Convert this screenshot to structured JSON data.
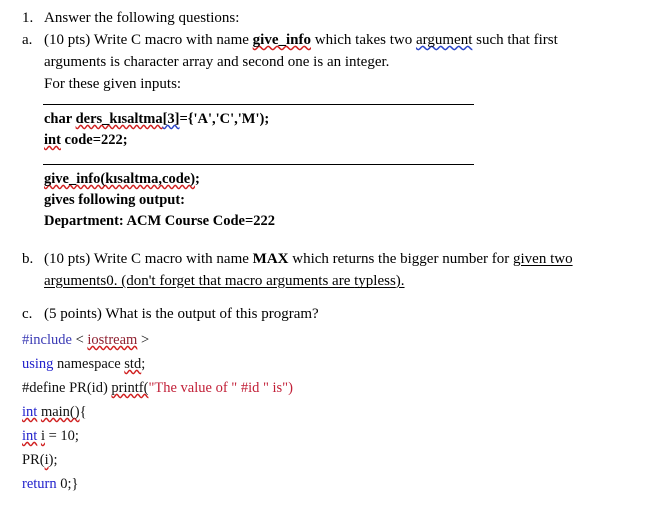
{
  "document": {
    "type": "exam-question-sheet",
    "colors": {
      "text": "#000000",
      "keyword_blue": "#2222CC",
      "string_red": "#C22038",
      "spell_squiggle_red": "#D02020",
      "grammar_squiggle_blue": "#2B45C8",
      "background": "#FFFFFF"
    },
    "questions": [
      {
        "marker": "1.",
        "lines": [
          "Answer the following questions:"
        ]
      },
      {
        "marker": "a.",
        "line1_a": "(10 pts) Write C macro with name ",
        "line1_bold": "give_info",
        "line1_b": " which takes two ",
        "line1_grammar": "argument",
        "line1_c": " such that first",
        "line2": "arguments is character array and second one is an integer.",
        "line3": "For these given inputs:"
      },
      {
        "marker": "b.",
        "line1_a": "(10 pts) Write C macro with name ",
        "line1_bold": "MAX",
        "line1_b": " which returns the bigger number for ",
        "line1_underline": "given two",
        "line2_underline_a": "arguments0. (don't forget that macro arguments are ",
        "line2_spell": "typless",
        "line2_underline_b": ")."
      },
      {
        "marker": "c.",
        "lines": [
          "(5 points) What is the output of this program?"
        ]
      }
    ],
    "given_inputs_block": {
      "line1_a": "char ",
      "line1_spell": "ders_kısaltma",
      "line1_b": "[3]",
      "line1_c": "={'A','C','M');",
      "line2_spell": "int",
      "line2_rest": " code=222;"
    },
    "output_block": {
      "line1_spell": "give_info(kısaltma,code)",
      "line1_rest": ";",
      "line2": "gives following output:",
      "line3": "Department: ACM Course Code=222"
    },
    "program": {
      "lines": [
        {
          "id": "include",
          "tokens": [
            {
              "text": "#include",
              "style": "pre"
            },
            {
              "text": " < ",
              "style": "idr"
            },
            {
              "text": "iostream",
              "style": "inc-name sq-red"
            },
            {
              "text": " >",
              "style": "idr"
            }
          ]
        },
        {
          "id": "using",
          "tokens": [
            {
              "text": "using",
              "style": "kw"
            },
            {
              "text": " namespace ",
              "style": "idr"
            },
            {
              "text": "std",
              "style": "idr sq-red"
            },
            {
              "text": ";",
              "style": "idr"
            }
          ]
        },
        {
          "id": "define",
          "tokens": [
            {
              "text": "#define PR(id) ",
              "style": "idr"
            },
            {
              "text": "printf(",
              "style": "idr sq-red"
            },
            {
              "text": "\"The value of \" #id \" is\")",
              "style": "str"
            }
          ]
        },
        {
          "id": "main",
          "tokens": [
            {
              "text": "int",
              "style": "kw sq-red"
            },
            {
              "text": " ",
              "style": "idr"
            },
            {
              "text": "main()",
              "style": "idr sq-red"
            },
            {
              "text": "{",
              "style": "idr"
            }
          ]
        },
        {
          "id": "decl-i",
          "tokens": [
            {
              "text": "int",
              "style": "kw sq-red"
            },
            {
              "text": " ",
              "style": "idr"
            },
            {
              "text": "i",
              "style": "idr sq-red"
            },
            {
              "text": " = 10;",
              "style": "idr"
            }
          ]
        },
        {
          "id": "call-pr",
          "tokens": [
            {
              "text": "PR(",
              "style": "idr"
            },
            {
              "text": "i",
              "style": "idr sq-red"
            },
            {
              "text": ");",
              "style": "idr"
            }
          ]
        },
        {
          "id": "return",
          "tokens": [
            {
              "text": "return",
              "style": "kw"
            },
            {
              "text": " 0;}",
              "style": "idr"
            }
          ]
        }
      ]
    }
  }
}
